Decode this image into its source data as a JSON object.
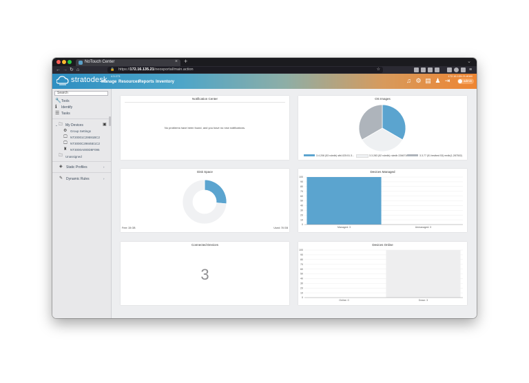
{
  "browser": {
    "tab_title": "NoTouch Center",
    "url_prefix": "https://",
    "url_host": "172.16.135.21",
    "url_path": "/neosportal/main.action"
  },
  "app": {
    "brand": "stratodesk",
    "version": "4.5.273",
    "ip": "172.16.135.21:8080",
    "user": "admin",
    "menu": [
      "Manage",
      "Resources",
      "Reports",
      "Inventory"
    ]
  },
  "sidebar": {
    "search_placeholder": "Search",
    "tools": [
      {
        "label": "Tools",
        "icon": "wrench-icon"
      },
      {
        "label": "Identify",
        "icon": "info-icon"
      },
      {
        "label": "Tasks",
        "icon": "list-icon"
      }
    ],
    "my_devices": "My Devices",
    "tree_items": [
      "Group Settings",
      "NT20001C29591BC2",
      "NT3000C29845E1C2",
      "NT3000A000D8F095"
    ],
    "unassigned": "Unassigned",
    "static_profiles": "Static Profiles",
    "dynamic_rules": "Dynamic Rules"
  },
  "cards": {
    "notifications": {
      "title": "Notification Center",
      "message": "No problems have been found, and you have no new notifications."
    },
    "os_images": {
      "title": "OS Images",
      "legend": [
        "3.4.206 (53 ruledb) stbl-025:51.3...",
        "3.3.283 (52 ruledb) ruledb 2266710...",
        "3.3.77 (51 testbed 53) mrdb(1-287502)"
      ]
    },
    "disk_space": {
      "title": "Disk Space",
      "free_label": "Free: 28 GB",
      "used_label": "Used: 78 GB"
    },
    "devices_managed": {
      "title": "Devices Managed",
      "x_labels": [
        "Managed: 3",
        "Unmanaged: 0"
      ]
    },
    "connected": {
      "title": "Connected Devices",
      "value": "3"
    },
    "devices_online": {
      "title": "Devices Online",
      "x_labels": [
        "Online: 0",
        "Down: 3"
      ]
    }
  },
  "chart_data": [
    {
      "type": "pie",
      "title": "OS Images",
      "labels": [
        "3.4.206 (53 ruledb) stbl-025:51.3...",
        "3.3.283 (52 ruledb) ruledb 2266710...",
        "3.3.77 (51 testbed 53) mrdb(1-287502)"
      ],
      "values": [
        1,
        1,
        1
      ],
      "colors": [
        "#5ba4cf",
        "#eef0f2",
        "#aeb4bb"
      ]
    },
    {
      "type": "pie",
      "title": "Disk Space",
      "labels": [
        "Free",
        "Used"
      ],
      "values": [
        28,
        78
      ],
      "colors": [
        "#5ba4cf",
        "#f0f1f3"
      ]
    },
    {
      "type": "bar",
      "title": "Devices Managed",
      "categories": [
        "Managed: 3",
        "Unmanaged: 0"
      ],
      "values": [
        100,
        0
      ],
      "ylim": [
        0,
        100
      ],
      "yticks": [
        0,
        10,
        20,
        30,
        40,
        50,
        60,
        70,
        80,
        90,
        100
      ],
      "colors": [
        "#5ba4cf",
        "#5ba4cf"
      ]
    },
    {
      "type": "bar",
      "title": "Devices Online",
      "categories": [
        "Online: 0",
        "Down: 3"
      ],
      "values": [
        0,
        100
      ],
      "ylim": [
        0,
        100
      ],
      "yticks": [
        0,
        10,
        20,
        30,
        40,
        50,
        60,
        70,
        80,
        90,
        100
      ],
      "colors": [
        "#eeeeef",
        "#eeeeef"
      ]
    }
  ]
}
